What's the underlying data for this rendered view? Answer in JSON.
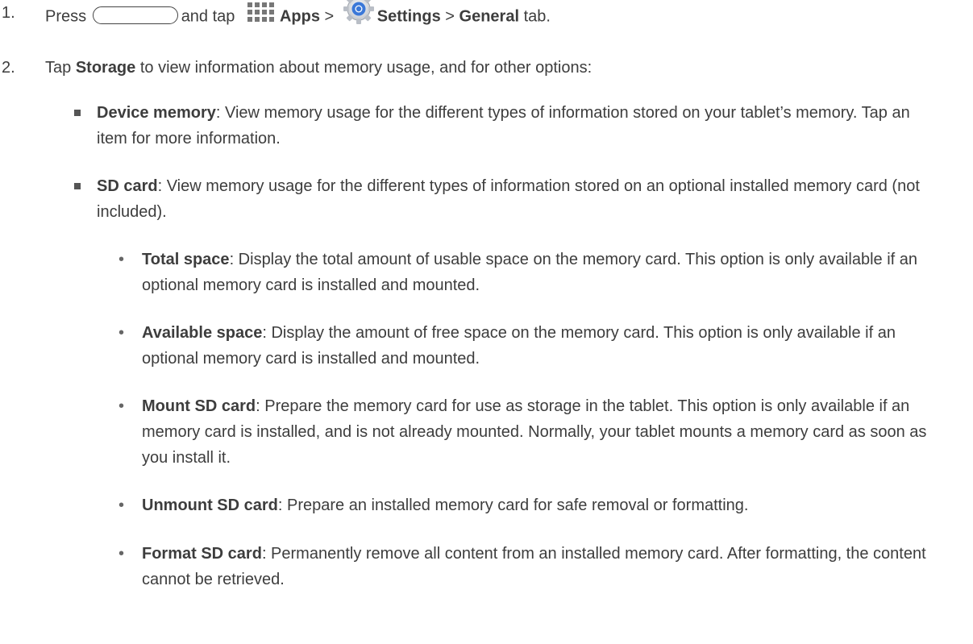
{
  "steps": [
    {
      "number": "1.",
      "press": "Press",
      "and_tap": "and tap",
      "apps": "Apps",
      "sep1": ">",
      "settings": "Settings",
      "sep2": ">",
      "general": "General",
      "tab": "tab.",
      "icons": [
        "home-button-icon",
        "apps-grid-icon",
        "settings-gear-icon"
      ]
    },
    {
      "number": "2.",
      "tap": "Tap",
      "storage": "Storage",
      "rest": "to view information about memory usage, and for other options:"
    }
  ],
  "bullets": [
    {
      "term": "Device memory",
      "desc": ": View memory usage for the different types of information stored on your tablet’s memory. Tap an item for more information."
    },
    {
      "term": "SD card",
      "desc": ": View memory usage for the different types of information stored on an optional installed memory card (not included)."
    }
  ],
  "sub_bullets": [
    {
      "term": "Total space",
      "desc": ": Display the total amount of usable space on the memory card. This option is only available if an optional memory card is installed and mounted."
    },
    {
      "term": "Available space",
      "desc": ": Display the amount of free space on the memory card. This option is only available if an optional memory card is installed and mounted."
    },
    {
      "term": "Mount SD card",
      "desc": ": Prepare the memory card for use as storage in the tablet. This option is only available if an memory card is installed, and is not already mounted. Normally, your tablet mounts a memory card as soon as you install it."
    },
    {
      "term": "Unmount SD card",
      "desc": ": Prepare an installed memory card for safe removal or formatting."
    },
    {
      "term": "Format SD card",
      "desc": ": Permanently remove all content from an installed memory card. After formatting, the content cannot be retrieved."
    }
  ],
  "colors": {
    "text": "#3d3d3d",
    "gear_blue": "#3b78d8",
    "icon_gray": "#777777"
  }
}
